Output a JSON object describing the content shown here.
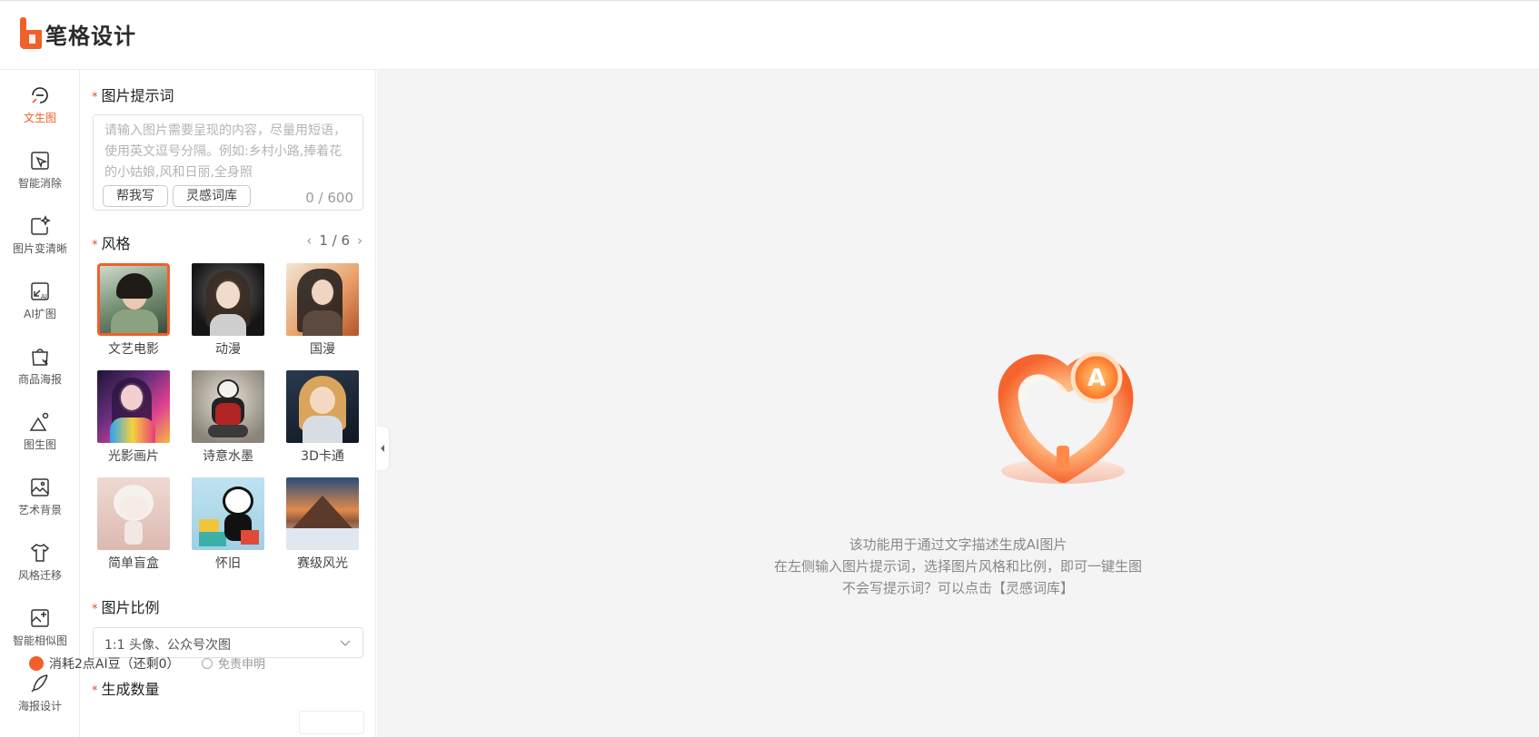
{
  "brand": {
    "name": "笔格设计",
    "accent": "#f0602b"
  },
  "nav": {
    "items": [
      {
        "label": "文生图",
        "icon": "text-to-image-icon",
        "active": true
      },
      {
        "label": "智能消除",
        "icon": "smart-erase-icon"
      },
      {
        "label": "图片变清晰",
        "icon": "enhance-icon"
      },
      {
        "label": "AI扩图",
        "icon": "ai-expand-icon"
      },
      {
        "label": "商品海报",
        "icon": "product-poster-icon"
      },
      {
        "label": "图生图",
        "icon": "image-to-image-icon"
      },
      {
        "label": "艺术背景",
        "icon": "art-background-icon"
      },
      {
        "label": "风格迁移",
        "icon": "style-transfer-icon"
      },
      {
        "label": "智能相似图",
        "icon": "similar-image-icon"
      },
      {
        "label": "海报设计",
        "icon": "poster-design-icon"
      }
    ]
  },
  "prompt": {
    "title": "图片提示词",
    "required_mark": "*",
    "placeholder": "请输入图片需要呈现的内容，尽量用短语，使用英文逗号分隔。例如:乡村小路,捧着花的小姑娘,风和日丽,全身照",
    "help_button": "帮我写",
    "library_button": "灵感词库",
    "counter": "0 / 600"
  },
  "style": {
    "title": "风格",
    "page": "1 / 6",
    "prev_arrow": "‹",
    "next_arrow": "›",
    "options": [
      {
        "label": "文艺电影",
        "selected": true
      },
      {
        "label": "动漫"
      },
      {
        "label": "国漫"
      },
      {
        "label": "光影画片"
      },
      {
        "label": "诗意水墨"
      },
      {
        "label": "3D卡通"
      },
      {
        "label": "简单盲盒"
      },
      {
        "label": "怀旧"
      },
      {
        "label": "赛级风光"
      }
    ]
  },
  "ratio": {
    "title": "图片比例",
    "value": "1:1 头像、公众号次图"
  },
  "quantity": {
    "title": "生成数量"
  },
  "footer": {
    "cost": "消耗2点AI豆（还剩0）",
    "disclaimer": "免责申明"
  },
  "canvas": {
    "line1": "该功能用于通过文字描述生成AI图片",
    "line2": "在左侧输入图片提示词，选择图片风格和比例，即可一键生图",
    "line3": "不会写提示词？可以点击【灵感词库】"
  }
}
